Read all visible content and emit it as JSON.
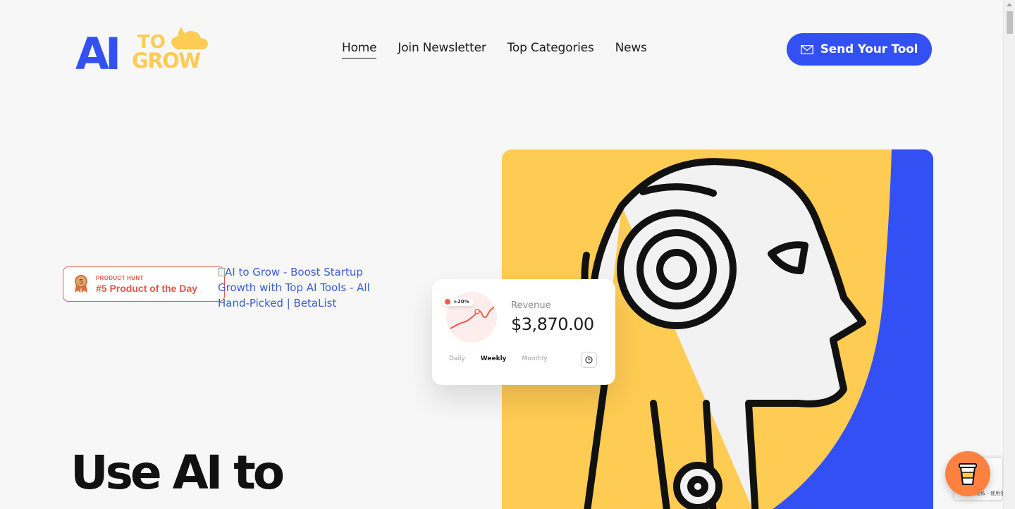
{
  "logo": {
    "text_ai": "AI",
    "text_to": "TO",
    "text_grow": "GROW"
  },
  "nav": [
    {
      "label": "Home",
      "active": true
    },
    {
      "label": "Join Newsletter"
    },
    {
      "label": "Top Categories"
    },
    {
      "label": "News"
    }
  ],
  "cta": {
    "label": "Send Your Tool",
    "icon": "mail-icon"
  },
  "producthunt": {
    "rank": "5",
    "eyebrow": "PRODUCT HUNT",
    "title": "#5 Product of the Day"
  },
  "betalist": {
    "alt": "AI to Grow - Boost Startup Growth with Top AI Tools - All Hand-Picked | BetaList"
  },
  "hero": {
    "title": "Use AI to"
  },
  "revenue_card": {
    "badge": "+20%",
    "label": "Revenue",
    "value": "$3,870.00",
    "tabs": [
      "Daily",
      "Weekly",
      "Monthly"
    ],
    "active_tab": "Weekly"
  },
  "recaptcha": {
    "text": "隐私 - 使用条款"
  },
  "colors": {
    "accent": "#3350f5",
    "yellow": "#fecb53",
    "badge_red": "#e2574c",
    "coffee": "#ff813f"
  }
}
